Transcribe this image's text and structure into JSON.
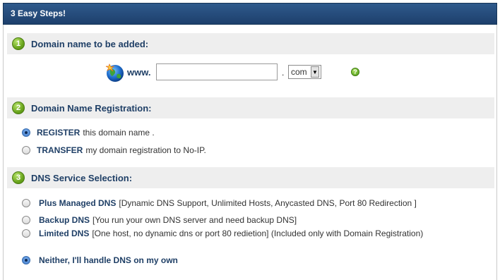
{
  "panel": {
    "title": "3 Easy Steps!"
  },
  "step1": {
    "number": "1",
    "title": "Domain name to be added:",
    "www_label": "www.",
    "domain_value": "",
    "dot": ".",
    "tld_selected": "com",
    "help_label": "?"
  },
  "step2": {
    "number": "2",
    "title": "Domain Name Registration:",
    "options": [
      {
        "label": "REGISTER",
        "text": "this domain name .",
        "selected": true
      },
      {
        "label": "TRANSFER",
        "text": "my domain registration to No-IP.",
        "selected": false
      }
    ]
  },
  "step3": {
    "number": "3",
    "title": "DNS Service Selection:",
    "options": [
      {
        "label": "Plus Managed DNS",
        "text": "[Dynamic DNS Support, Unlimited Hosts, Anycasted DNS, Port 80 Redirection ]",
        "selected": false
      },
      {
        "label": "Backup DNS",
        "text": "[You run your own DNS server and need backup DNS]",
        "selected": false
      },
      {
        "label": "Limited DNS",
        "text": "[One host, no dynamic dns or port 80 redietion] (Included only with Domain Registration)",
        "selected": false
      },
      {
        "label": "Neither, I'll handle DNS on my own",
        "text": "",
        "selected": true
      }
    ]
  }
}
